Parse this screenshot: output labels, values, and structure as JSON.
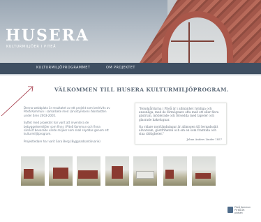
{
  "header": {
    "brand_title": "HUSERA",
    "brand_subtitle": "KULTURMILJÖER I PITEÅ"
  },
  "nav": {
    "items": [
      {
        "label": "KULTURMILJÖPROGRAMMET"
      },
      {
        "label": "OM PROJEKTET"
      }
    ]
  },
  "main": {
    "welcome_heading": "VÄLKOMMEN TILL HUSERA KULTURMILJÖPROGRAM.",
    "intro_paragraphs": [
      "Denna webbplats är resultatet av ett projekt som bedrivits av Piteå Kommun i samarbete med Länsstyrelsen i Norrbotten under åren 2003-2005.",
      "Syftet med projektet har varit att inventera de bebyggelsemiljöer som finns i Piteå Kommun och finna särskilt bevarade värde miljöer som skall skyddas genom ett kulturmiljöprogram.",
      "Projektledare har varit Sara Berg (Byggnadsantikvarie)"
    ],
    "quote": {
      "paragraphs": [
        "\"Bondgårdarna i Piteå är i allmänhet rymliga och ansenliga, med de förmögnare ofta med ett eller flera gästrum, möblerade och försedda med tapeter och glasrade kakelugnar.",
        "Ga vidare norrländningar är allmogen till levnadssätt allvarsam, gästfriheten och om en som framtida och sina rättigheter.\""
      ],
      "attribution": "Johan Anders Linder 1857"
    }
  },
  "gallery": {
    "thumbnails": [
      {
        "label": "thumb-1"
      },
      {
        "label": "thumb-2"
      },
      {
        "label": "thumb-3"
      },
      {
        "label": "thumb-4"
      },
      {
        "label": "thumb-5"
      },
      {
        "label": "thumb-6"
      },
      {
        "label": "thumb-7"
      }
    ]
  },
  "footer": {
    "logo_text": "Piteå Kommun\nPITEÅ ÄR\nplatsen"
  },
  "colors": {
    "nav_bg": "#3f4f62",
    "heading": "#5d6a78",
    "accent_roof": "#a9574a"
  }
}
